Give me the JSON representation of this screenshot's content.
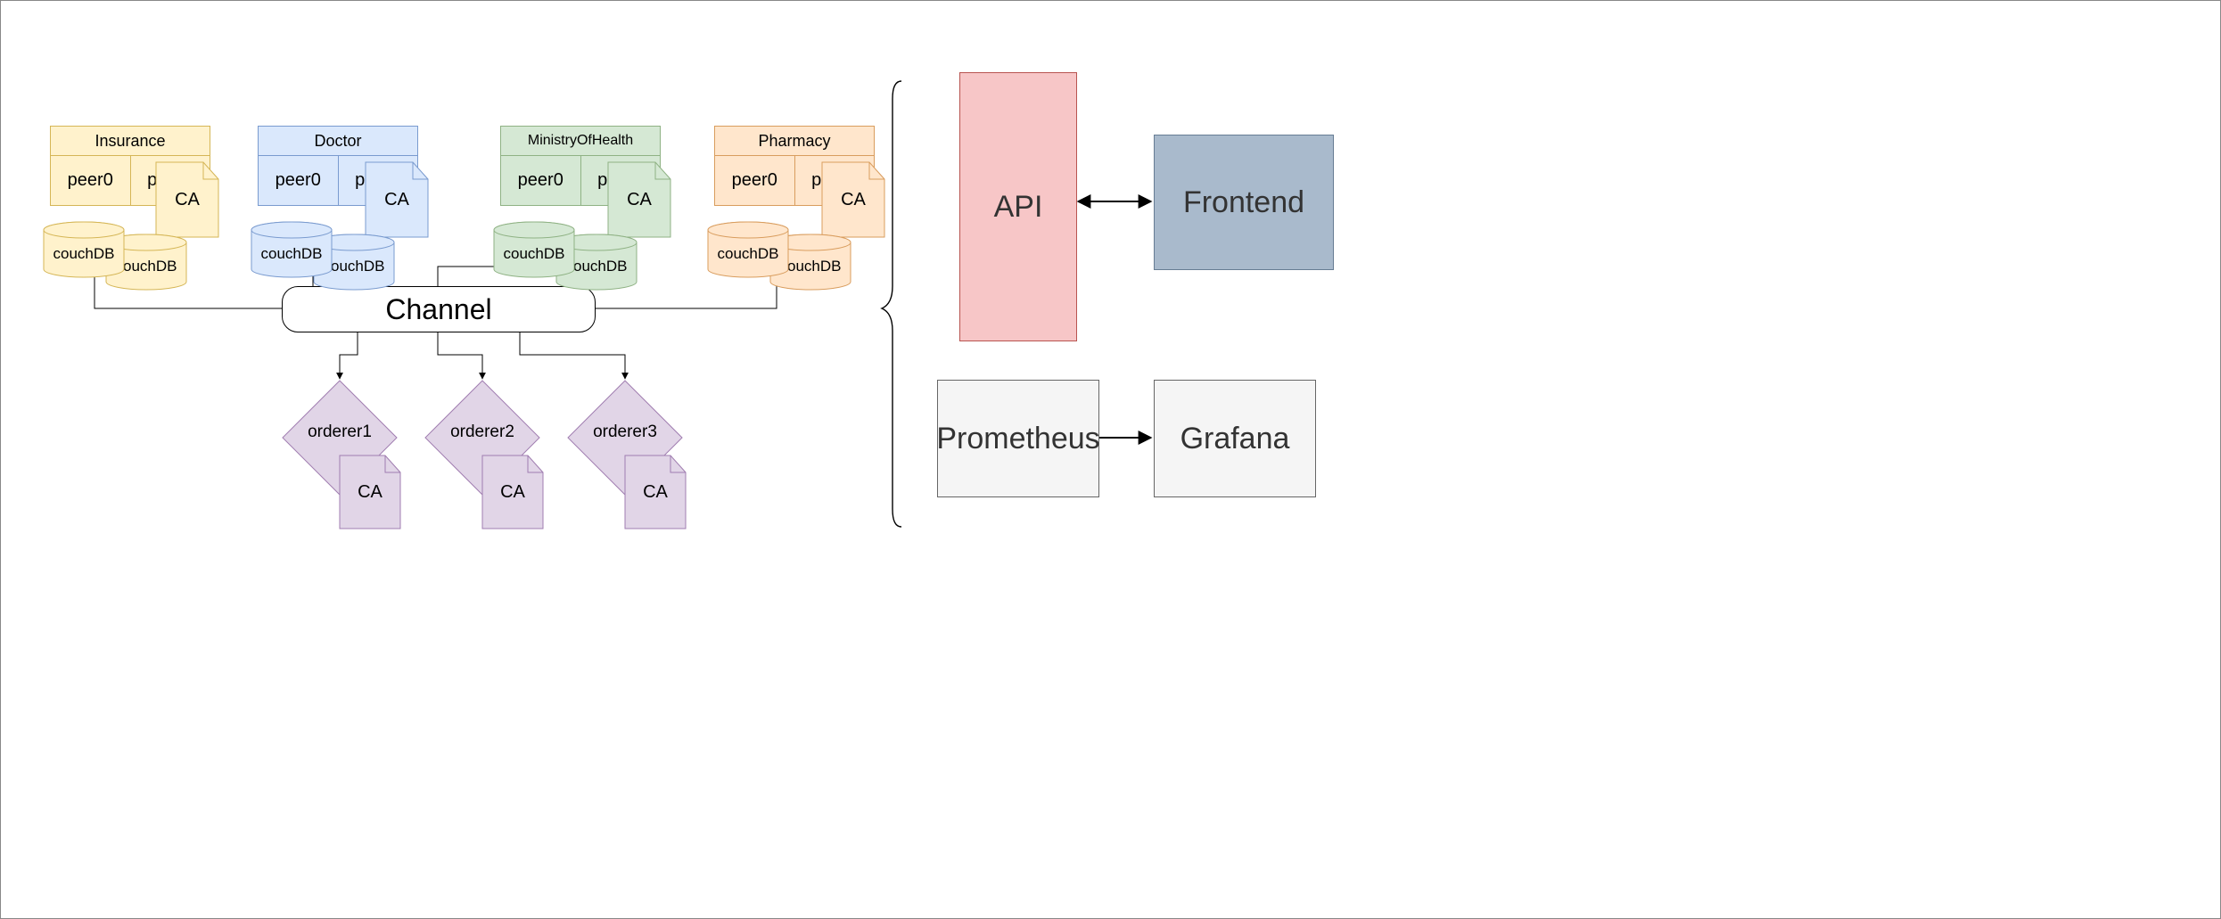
{
  "common": {
    "peer0": "peer0",
    "peer1": "peer1",
    "couchdb": "couchDB",
    "ca": "CA"
  },
  "orgs": {
    "insurance": {
      "name": "Insurance"
    },
    "doctor": {
      "name": "Doctor"
    },
    "ministry": {
      "name": "MinistryOfHealth"
    },
    "pharmacy": {
      "name": "Pharmacy"
    }
  },
  "channel": {
    "label": "Channel"
  },
  "orderers": {
    "o1": "orderer1",
    "o2": "orderer2",
    "o3": "orderer3"
  },
  "right": {
    "api": "API",
    "frontend": "Frontend",
    "prom": "Prometheus",
    "grafana": "Grafana"
  }
}
